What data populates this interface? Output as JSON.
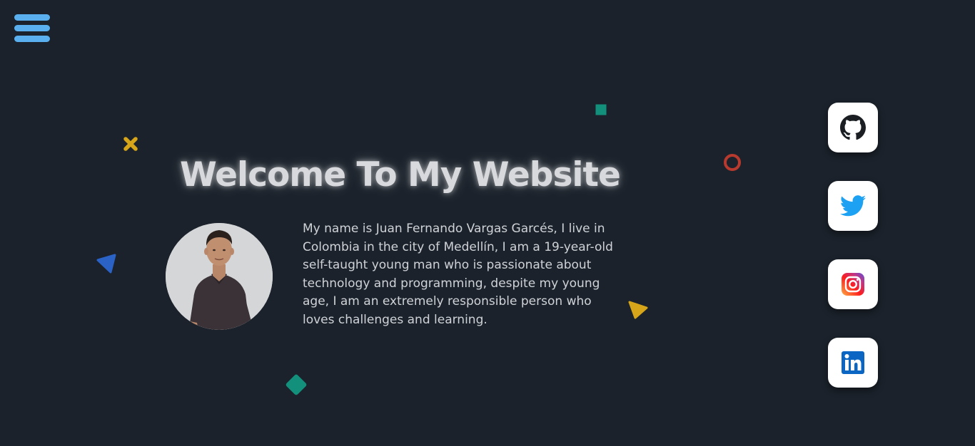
{
  "nav": {
    "menu_icon": "hamburger-menu-icon"
  },
  "hero": {
    "title": "Welcome To My Website",
    "bio": "My name is Juan Fernando Vargas Garcés, I live in Colombia in the city of Medellín, I am a 19-year-old self-taught young man who is passionate about technology and programming, despite my young age, I am an extremely responsible person who loves challenges and learning.",
    "photo": "profile-photo"
  },
  "social_links": [
    {
      "name": "GitHub",
      "icon": "github-icon"
    },
    {
      "name": "Twitter",
      "icon": "twitter-icon"
    },
    {
      "name": "Instagram",
      "icon": "instagram-icon"
    },
    {
      "name": "LinkedIn",
      "icon": "linkedin-icon"
    }
  ],
  "colors": {
    "background": "#1b222b",
    "menu_accent": "#5ab0ee",
    "title_text": "#d7d9dc",
    "body_text": "#cfd3d7",
    "deco_yellow": "#d6a519",
    "deco_teal": "#13907c",
    "deco_red": "#b83a2e",
    "deco_blue": "#2a62c6"
  }
}
